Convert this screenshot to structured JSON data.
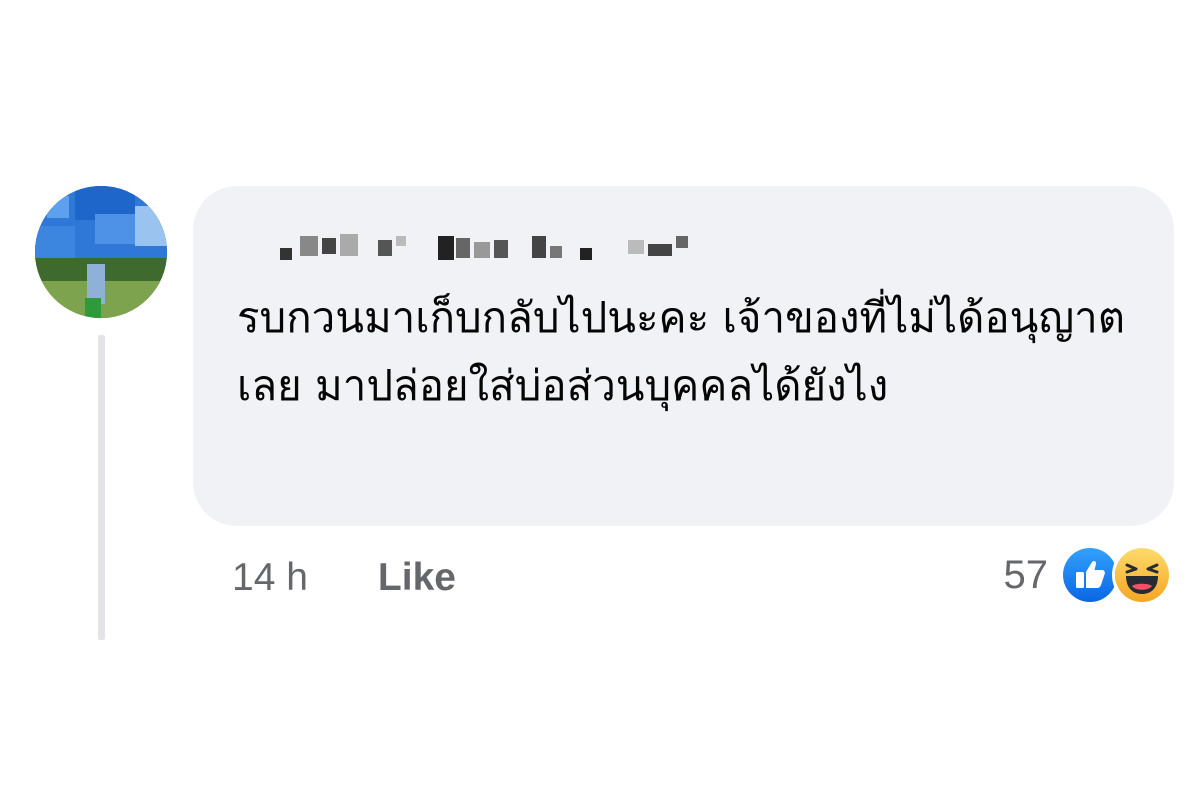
{
  "comment": {
    "author_name": "",
    "text": "รบกวนมาเก็บกลับไปนะคะ เจ้าของที่ไม่ได้อนุญาตเลย มาปล่อยใส่บ่อส่วนบุคคลได้ยังไง",
    "timestamp": "14 h",
    "like_label": "Like",
    "reaction_count": "57",
    "reactions": [
      "like-icon",
      "haha-icon"
    ]
  },
  "colors": {
    "bubble_bg": "#f0f2f5",
    "text": "#050505",
    "meta": "#65676b",
    "like_blue": "#1877f2",
    "haha_yellow": "#f7b125"
  }
}
